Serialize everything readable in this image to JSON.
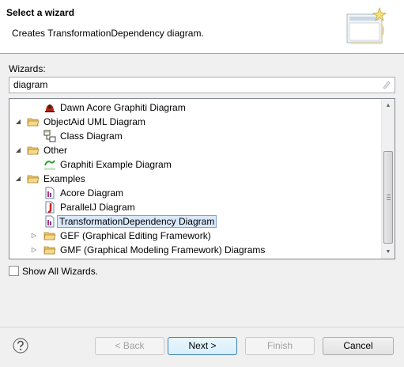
{
  "header": {
    "title": "Select a wizard",
    "description": "Creates TransformationDependency diagram."
  },
  "wizards_label": "Wizards:",
  "filter": {
    "value": "diagram"
  },
  "tree": {
    "rows": [
      {
        "label": "Dawn Acore Graphiti Diagram",
        "icon": "dawn-icon"
      },
      {
        "label": "ObjectAid UML Diagram",
        "icon": "folder-icon",
        "expanded": true
      },
      {
        "label": "Class Diagram",
        "icon": "class-diagram-icon"
      },
      {
        "label": "Other",
        "icon": "folder-icon",
        "expanded": true
      },
      {
        "label": "Graphiti Example Diagram",
        "icon": "graphiti-icon"
      },
      {
        "label": "Examples",
        "icon": "folder-icon",
        "expanded": true
      },
      {
        "label": "Acore Diagram",
        "icon": "diagram-file-icon"
      },
      {
        "label": "ParallelJ Diagram",
        "icon": "parallelj-icon"
      },
      {
        "label": "TransformationDependency Diagram",
        "icon": "diagram-file-icon",
        "selected": true
      },
      {
        "label": "GEF (Graphical Editing Framework)",
        "icon": "folder-icon",
        "expanded": false
      },
      {
        "label": "GMF (Graphical Modeling Framework) Diagrams",
        "icon": "folder-icon",
        "expanded": false
      }
    ]
  },
  "show_all_label": "Show All Wizards.",
  "buttons": {
    "back": "< Back",
    "next": "Next >",
    "finish": "Finish",
    "cancel": "Cancel"
  },
  "colors": {
    "selection_bg": "#d9e8fb",
    "selection_border": "#7da2ce",
    "folder": "#e8c46a"
  }
}
